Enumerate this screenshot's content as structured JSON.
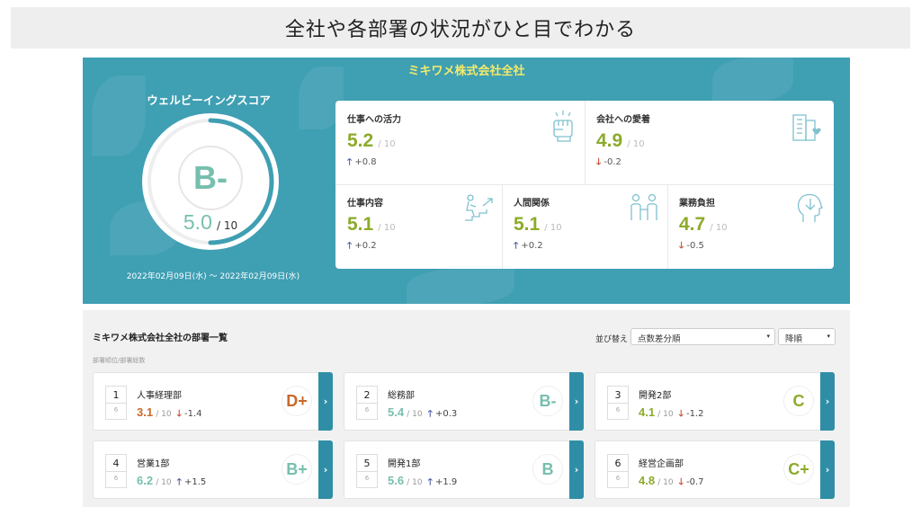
{
  "page_title": "全社や各部署の状況がひと目でわかる",
  "company_title": "ミキワメ株式会社全社",
  "wellbeing": {
    "label": "ウェルビーイングスコア",
    "grade": "B-",
    "score": "5.0",
    "denominator": "/ 10",
    "score_fraction": 0.5,
    "date_range": "2022年02月09日(水) 〜 2022年02月09日(水)"
  },
  "metrics": [
    {
      "label": "仕事への活力",
      "value": "5.2",
      "den": "/ 10",
      "dir": "up",
      "delta": "+0.8",
      "icon": "fist-icon"
    },
    {
      "label": "会社への愛着",
      "value": "4.9",
      "den": "/ 10",
      "dir": "down",
      "delta": "-0.2",
      "icon": "building-heart-icon"
    },
    {
      "label": "仕事内容",
      "value": "5.1",
      "den": "/ 10",
      "dir": "up",
      "delta": "+0.2",
      "icon": "stairs-climber-icon"
    },
    {
      "label": "人間関係",
      "value": "5.1",
      "den": "/ 10",
      "dir": "up",
      "delta": "+0.2",
      "icon": "people-icon"
    },
    {
      "label": "業務負担",
      "value": "4.7",
      "den": "/ 10",
      "dir": "down",
      "delta": "-0.5",
      "icon": "head-down-arrow-icon"
    }
  ],
  "departments": {
    "title": "ミキワメ株式会社全社の部署一覧",
    "subtitle": "部署順位/部署総数",
    "sort_label": "並び替え",
    "sort_select": "点数差分順",
    "order_select": "降順",
    "items": [
      {
        "rank": "1",
        "total": "6",
        "name": "人事経理部",
        "value": "3.1",
        "den": "/ 10",
        "dir": "down",
        "delta": "-1.4",
        "grade": "D+",
        "color": "#c96a2b"
      },
      {
        "rank": "2",
        "total": "6",
        "name": "総務部",
        "value": "5.4",
        "den": "/ 10",
        "dir": "up",
        "delta": "+0.3",
        "grade": "B-",
        "color": "#76bfae"
      },
      {
        "rank": "3",
        "total": "6",
        "name": "開発2部",
        "value": "4.1",
        "den": "/ 10",
        "dir": "down",
        "delta": "-1.2",
        "grade": "C",
        "color": "#8cab2a"
      },
      {
        "rank": "4",
        "total": "6",
        "name": "営業1部",
        "value": "6.2",
        "den": "/ 10",
        "dir": "up",
        "delta": "+1.5",
        "grade": "B+",
        "color": "#76bfae"
      },
      {
        "rank": "5",
        "total": "6",
        "name": "開発1部",
        "value": "5.6",
        "den": "/ 10",
        "dir": "up",
        "delta": "+1.9",
        "grade": "B",
        "color": "#76bfae"
      },
      {
        "rank": "6",
        "total": "6",
        "name": "経営企画部",
        "value": "4.8",
        "den": "/ 10",
        "dir": "down",
        "delta": "-0.7",
        "grade": "C+",
        "color": "#8cab2a"
      }
    ]
  },
  "colors": {
    "hero_bg": "#3f9fb3",
    "accent_teal": "#76bfae",
    "accent_green": "#8cab2a",
    "up": "#4a5aa8",
    "down": "#c9452f",
    "card_arrow": "#2f8ea6"
  }
}
